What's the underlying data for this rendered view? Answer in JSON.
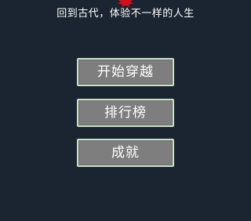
{
  "header": {
    "tagline": "回到古代，体验不一样的人生"
  },
  "menu": {
    "start_label": "开始穿越",
    "leaderboard_label": "排行榜",
    "achievements_label": "成就"
  },
  "colors": {
    "background": "#1b2431",
    "button_fill": "#7e7e7e",
    "button_border": "#c9e3c9",
    "logo_accent": "#d0101a",
    "text": "#ffffff"
  }
}
